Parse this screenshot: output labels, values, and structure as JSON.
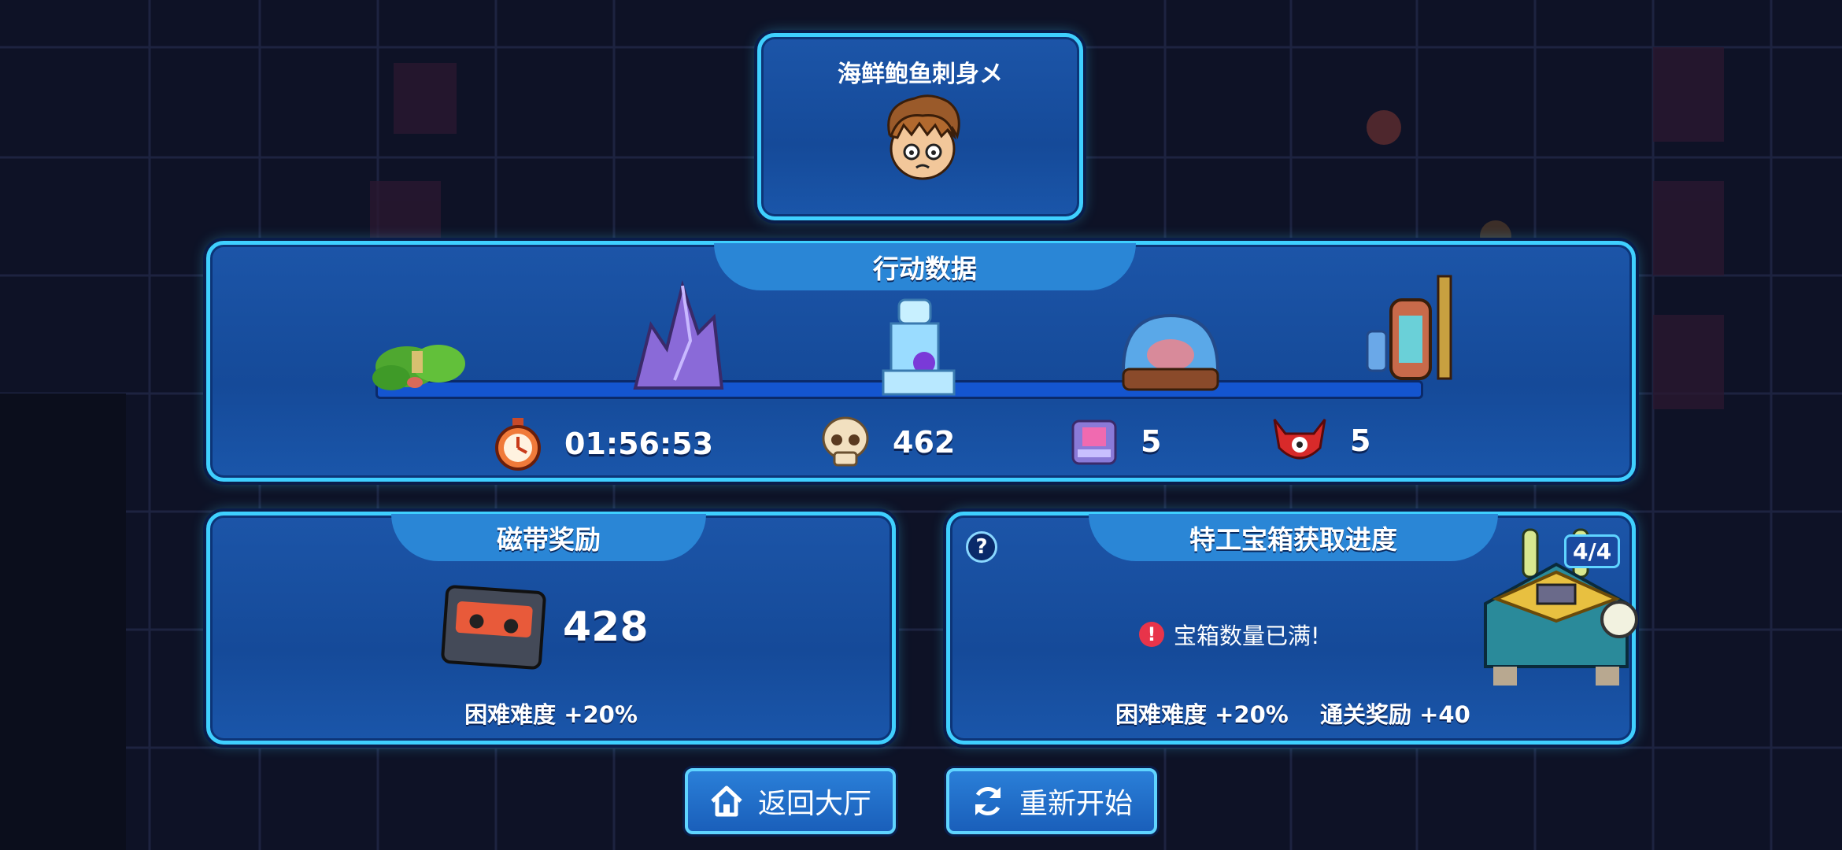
{
  "player": {
    "name": "海鲜鲍鱼刺身メ",
    "avatar_icon": "player-avatar"
  },
  "action_panel": {
    "title": "行动数据",
    "stages": [
      "forest-stage-icon",
      "crystal-stage-icon",
      "lab-stage-icon",
      "dome-stage-icon",
      "pipe-stage-icon"
    ],
    "stats": {
      "time": "01:56:53",
      "kills": "462",
      "rooms": "5",
      "bosses": "5"
    }
  },
  "tape_panel": {
    "title": "磁带奖励",
    "amount": "428",
    "bonus": "困难难度 +20%"
  },
  "chest_panel": {
    "title": "特工宝箱获取进度",
    "progress": "4/4",
    "status": "宝箱数量已满!",
    "bonus_difficulty": "困难难度 +20%",
    "bonus_clear": "通关奖励 +40"
  },
  "buttons": {
    "lobby": "返回大厅",
    "restart": "重新开始"
  },
  "colors": {
    "accent": "#3fd0ff",
    "panel": "#1a52a5",
    "alert": "#e8344a"
  }
}
